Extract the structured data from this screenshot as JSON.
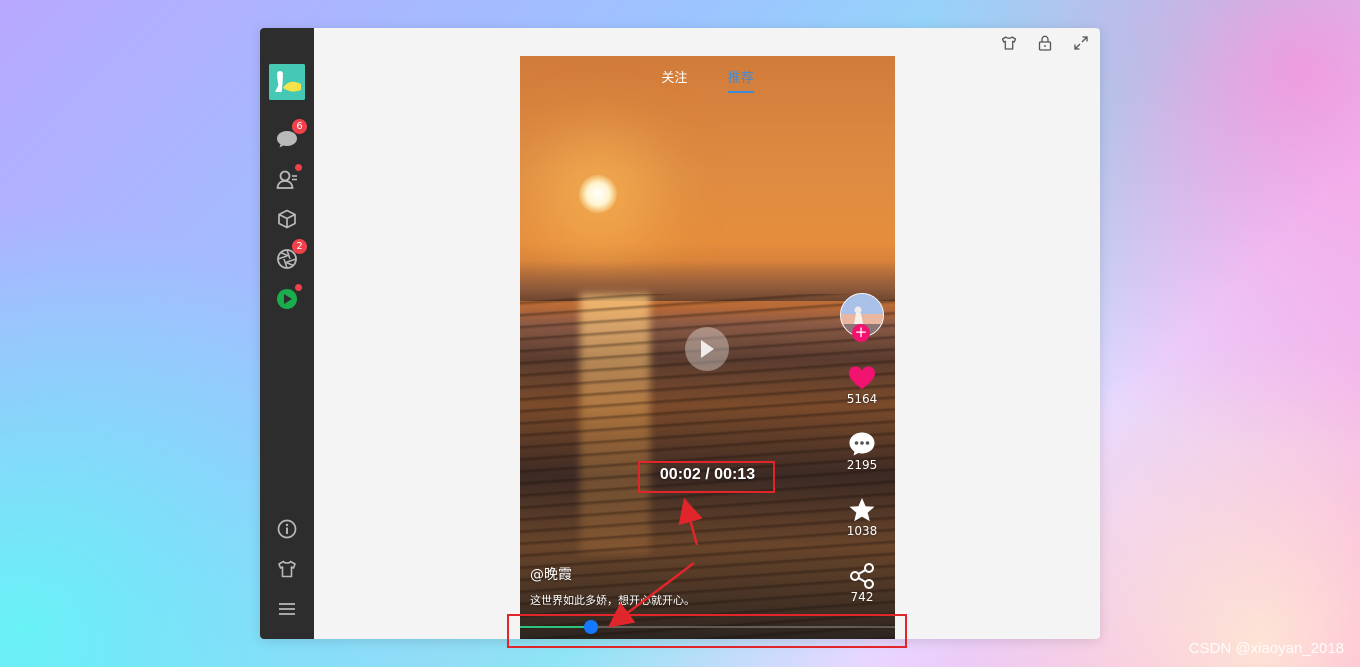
{
  "sidebar": {
    "message_badge": "6",
    "moments_badge": "2"
  },
  "video": {
    "tabs": [
      {
        "label": "关注",
        "active": false
      },
      {
        "label": "推荐",
        "active": true
      }
    ],
    "time_display": "00:02 / 00:13",
    "progress": 0.19,
    "author": "@晚霞",
    "description": "这世界如此多娇，想开心就开心。",
    "actions": {
      "likes": "5164",
      "comments": "2195",
      "favorites": "1038",
      "shares": "742"
    },
    "follow_symbol": "+"
  },
  "watermark": "CSDN @xiaoyan_2018",
  "colors": {
    "accent": "#3d8bd8",
    "like": "#f0136f",
    "progress": "#2fc27e",
    "thumb": "#1677ff",
    "annotation": "#e1262b"
  }
}
